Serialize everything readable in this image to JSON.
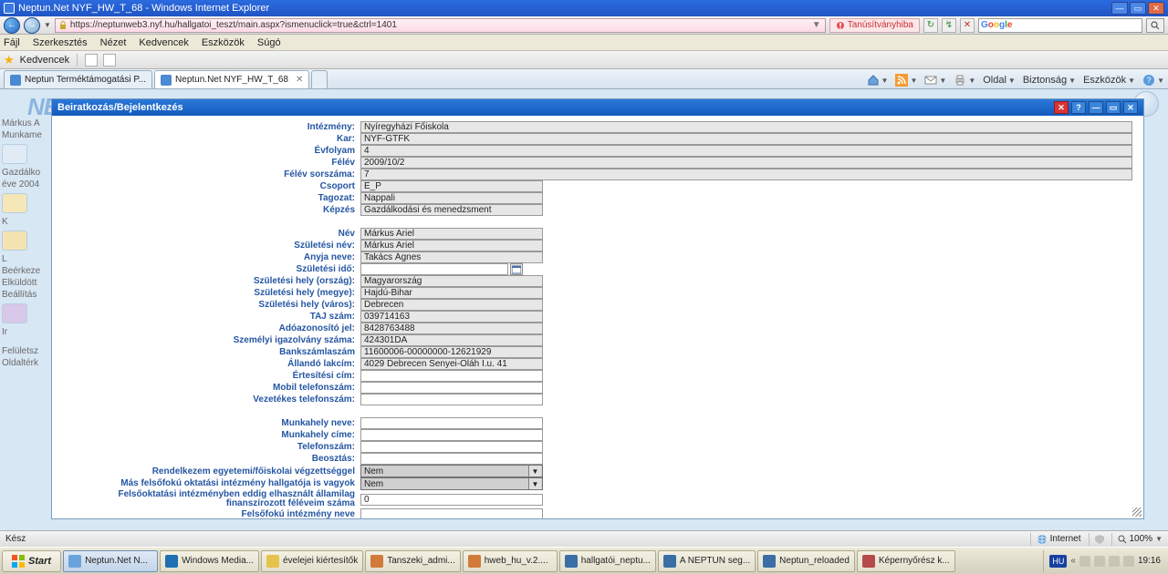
{
  "window": {
    "title": "Neptun.Net NYF_HW_T_68 - Windows Internet Explorer"
  },
  "nav": {
    "url": "https://neptunweb3.nyf.hu/hallgatoi_teszt/main.aspx?ismenuclick=true&ctrl=1401",
    "cert_warn": "Tanúsítványhiba",
    "search_placeholder": "Google"
  },
  "menu": {
    "items": [
      "Fájl",
      "Szerkesztés",
      "Nézet",
      "Kedvencek",
      "Eszközök",
      "Súgó"
    ]
  },
  "favbar": {
    "label": "Kedvencek"
  },
  "tabs": {
    "items": [
      {
        "label": "Neptun Terméktámogatási P...",
        "active": false
      },
      {
        "label": "Neptun.Net NYF_HW_T_68",
        "active": true
      }
    ]
  },
  "ietoolbar": {
    "items": [
      "Oldal",
      "Biztonság",
      "Eszközök"
    ]
  },
  "background": {
    "logo": "NEOTUN",
    "side": [
      "Márkus A",
      "Munkame",
      "",
      "Gazdálko",
      "éve 2004",
      "",
      "K",
      "",
      "L",
      "Beérkeze",
      "Elküldött",
      "Beállítás",
      "",
      "Ir",
      "",
      "Felületsz",
      "Oldaltérk"
    ]
  },
  "dialog": {
    "title": "Beiratkozás/Bejelentkezés",
    "labels": {
      "intezmeny": "Intézmény:",
      "kar": "Kar:",
      "evfolyam": "Évfolyam",
      "felev": "Félév",
      "felev_sorszama": "Félév sorszáma:",
      "csoport": "Csoport",
      "tagozat": "Tagozat:",
      "kepzes": "Képzés",
      "nev": "Név",
      "szul_nev": "Születési név:",
      "anyja_neve": "Anyja neve:",
      "szul_ido": "Születési idő:",
      "szul_orszag": "Születési hely (ország):",
      "szul_megye": "Születési hely (megye):",
      "szul_varos": "Születési hely (város):",
      "taj": "TAJ szám:",
      "ado": "Adóazonosító jel:",
      "szig": "Személyi igazolvány száma:",
      "bank": "Bankszámlaszám",
      "lakcim": "Állandó lakcím:",
      "ert_cim": "Értesítési cím:",
      "mobil": "Mobil telefonszám:",
      "vezetekes": "Vezetékes telefonszám:",
      "mh_nev": "Munkahely neve:",
      "mh_cim": "Munkahely címe:",
      "mh_tel": "Telefonszám:",
      "beosztas": "Beosztás:",
      "vegzettseg": "Rendelkezem egyetemi/főiskolai végzettséggel",
      "mas_hallgato": "Más felsőfokú oktatási intézmény hallgatója is vagyok",
      "elhasznalt": "Felsőoktatási intézményben eddig elhasznált államilag finanszírozott féléveim száma",
      "ff_intezmeny": "Felsőfokú intézmény neve"
    },
    "values": {
      "intezmeny": "Nyíregyházi Főiskola",
      "kar": "NYF-GTFK",
      "evfolyam": "4",
      "felev": "2009/10/2",
      "felev_sorszama": "7",
      "csoport": "E_P",
      "tagozat": "Nappali",
      "kepzes": "Gazdálkodási és menedzsment",
      "nev": "Márkus Ariel",
      "szul_nev": "Márkus Ariel",
      "anyja_neve": "Takács Ágnes",
      "szul_ido": "",
      "szul_orszag": "Magyarország",
      "szul_megye": "Hajdú-Bihar",
      "szul_varos": "Debrecen",
      "taj": "039714163",
      "ado": "8428763488",
      "szig": "424301DA",
      "bank": "11600006-00000000-12621929",
      "lakcim": "4029 Debrecen Senyei-Oláh I.u. 41",
      "ert_cim": "",
      "mobil": "",
      "vezetekes": "",
      "mh_nev": "",
      "mh_cim": "",
      "mh_tel": "",
      "beosztas": "",
      "vegzettseg": "Nem",
      "mas_hallgato": "Nem",
      "elhasznalt": "0",
      "ff_intezmeny": ""
    }
  },
  "statusbar": {
    "ready": "Kész",
    "zone": "Internet",
    "zoom": "100%"
  },
  "taskbar": {
    "start": "Start",
    "items": [
      "Neptun.Net N...",
      "Windows Media...",
      "évelejei kiértesítők",
      "Tanszeki_admi...",
      "hweb_hu_v.2....",
      "hallgatói_neptu...",
      "A NEPTUN seg...",
      "Neptun_reloaded",
      "Képernyőrész k..."
    ],
    "lang": "HU",
    "clock": "19:16"
  }
}
